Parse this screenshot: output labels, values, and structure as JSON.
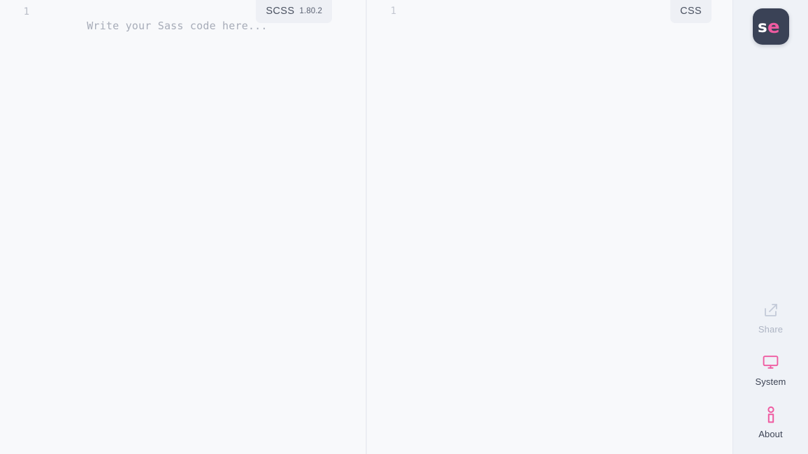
{
  "app": {
    "logo_text_primary": "s",
    "logo_text_accent": "e",
    "logo_bg": "#3a4256",
    "accent_color": "#ef5ba1",
    "muted_color": "#aeb5c4"
  },
  "editor": {
    "scss": {
      "line_number": "1",
      "placeholder": "Write your Sass code here...",
      "value": "",
      "badge_lang": "SCSS",
      "badge_version": "1.80.2"
    },
    "css": {
      "line_number": "1",
      "placeholder": "",
      "value": "",
      "badge_lang": "CSS",
      "badge_version": ""
    }
  },
  "sidebar": {
    "items": [
      {
        "label": "Share",
        "icon": "share-icon",
        "state": "muted"
      },
      {
        "label": "System",
        "icon": "monitor-icon",
        "state": "active"
      },
      {
        "label": "About",
        "icon": "info-icon",
        "state": "active"
      }
    ]
  }
}
